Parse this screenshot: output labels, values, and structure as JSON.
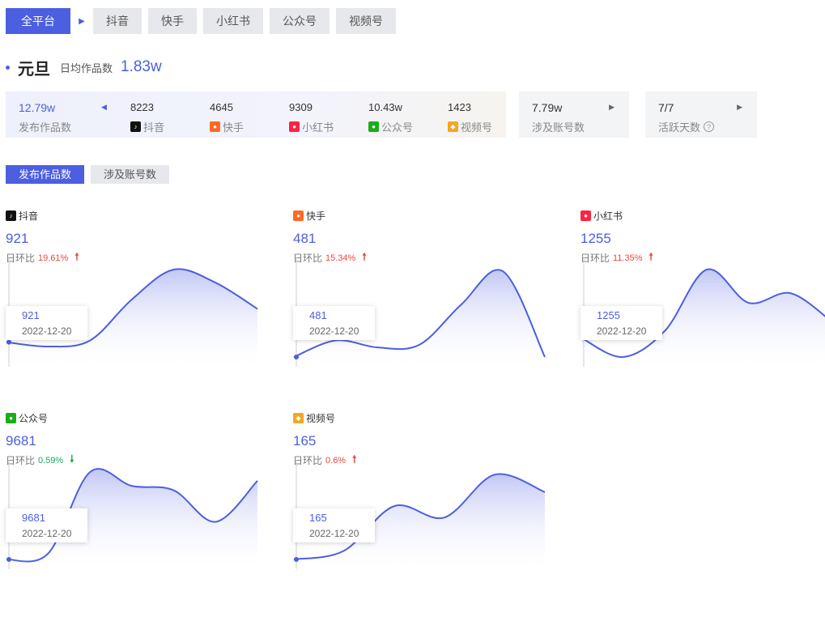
{
  "platform_tabs": {
    "active": "全平台",
    "items": [
      "抖音",
      "快手",
      "小红书",
      "公众号",
      "视频号"
    ]
  },
  "event": {
    "title": "元旦",
    "daily_label": "日均作品数",
    "daily_value": "1.83w"
  },
  "summary": {
    "total_value": "12.79w",
    "total_label": "发布作品数",
    "platforms": [
      {
        "value": "8223",
        "label": "抖音",
        "icon": "douyin-icon",
        "color": "#111111"
      },
      {
        "value": "4645",
        "label": "快手",
        "icon": "kuaishou-icon",
        "color": "#ff6a24"
      },
      {
        "value": "9309",
        "label": "小红书",
        "icon": "xiaohongshu-icon",
        "color": "#ff2442"
      },
      {
        "value": "10.43w",
        "label": "公众号",
        "icon": "wechat-icon",
        "color": "#1aad19"
      },
      {
        "value": "1423",
        "label": "视频号",
        "icon": "channels-icon",
        "color": "#f5a623"
      }
    ],
    "accounts_value": "7.79w",
    "accounts_label": "涉及账号数",
    "days_value": "7/7",
    "days_label": "活跃天数",
    "help_icon": "question-icon"
  },
  "metric_tabs": {
    "active": "发布作品数",
    "other": "涉及账号数"
  },
  "charts": [
    {
      "name": "抖音",
      "icon": "douyin-icon",
      "color": "#111111",
      "value": "921",
      "rate_label": "日环比",
      "rate": "19.61%",
      "trend": "up",
      "tooltip": {
        "value": "921",
        "date": "2022-12-20"
      },
      "series": [
        0.17,
        0.12,
        0.19,
        0.66,
        1.0,
        0.85,
        0.55
      ],
      "line_color": "#4c5fe0"
    },
    {
      "name": "快手",
      "icon": "kuaishou-icon",
      "color": "#ff6a24",
      "value": "481",
      "rate_label": "日环比",
      "rate": "15.34%",
      "trend": "up",
      "tooltip": {
        "value": "481",
        "date": "2022-12-20"
      },
      "series": [
        0.0,
        0.19,
        0.11,
        0.14,
        0.6,
        0.98,
        0.0
      ],
      "line_color": "#4c5fe0"
    },
    {
      "name": "小红书",
      "icon": "xiaohongshu-icon",
      "color": "#ff2442",
      "value": "1255",
      "rate_label": "日环比",
      "rate": "11.35%",
      "trend": "up",
      "tooltip": {
        "value": "1255",
        "date": "2022-12-20"
      },
      "series": [
        0.22,
        0.0,
        0.3,
        1.0,
        0.62,
        0.73,
        0.4
      ],
      "line_color": "#4c5fe0"
    },
    {
      "name": "公众号",
      "icon": "wechat-icon",
      "color": "#1aad19",
      "value": "9681",
      "rate_label": "日环比",
      "rate": "0.59%",
      "trend": "down",
      "tooltip": {
        "value": "9681",
        "date": "2022-12-20"
      },
      "series": [
        0.0,
        0.07,
        1.0,
        0.84,
        0.79,
        0.43,
        0.9
      ],
      "line_color": "#4c5fe0"
    },
    {
      "name": "视频号",
      "icon": "channels-icon",
      "color": "#f5a623",
      "value": "165",
      "rate_label": "日环比",
      "rate": "0.6%",
      "trend": "up",
      "tooltip": {
        "value": "165",
        "date": "2022-12-20"
      },
      "series": [
        0.0,
        0.1,
        0.61,
        0.48,
        0.97,
        0.77
      ],
      "line_color": "#4c5fe0"
    }
  ]
}
